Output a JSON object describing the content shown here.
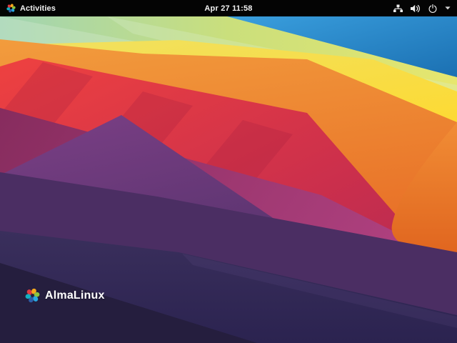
{
  "top_bar": {
    "activities": {
      "label": "Activities",
      "icon": "almalinux-pinwheel-icon"
    },
    "clock": {
      "text": "Apr 27 11:58"
    },
    "tray": {
      "icons": [
        "network-wired-icon",
        "volume-icon",
        "power-icon",
        "caret-down-icon"
      ]
    },
    "colors": {
      "background": "#040404",
      "text": "#f2f2f2"
    }
  },
  "desktop": {
    "brand": {
      "name": "AlmaLinux",
      "icon": "almalinux-pinwheel-icon"
    },
    "wallpaper": {
      "palette": {
        "mint": "#a0d4b4",
        "yellow_green": "#cadf7c",
        "sky_blue": "#2688cc",
        "yellow": "#ffd92c",
        "orange": "#ea7c2c",
        "red": "#e03a40",
        "magenta": "#a13c78",
        "purple": "#5c3684",
        "dark_navy": "#2a2250"
      }
    }
  }
}
